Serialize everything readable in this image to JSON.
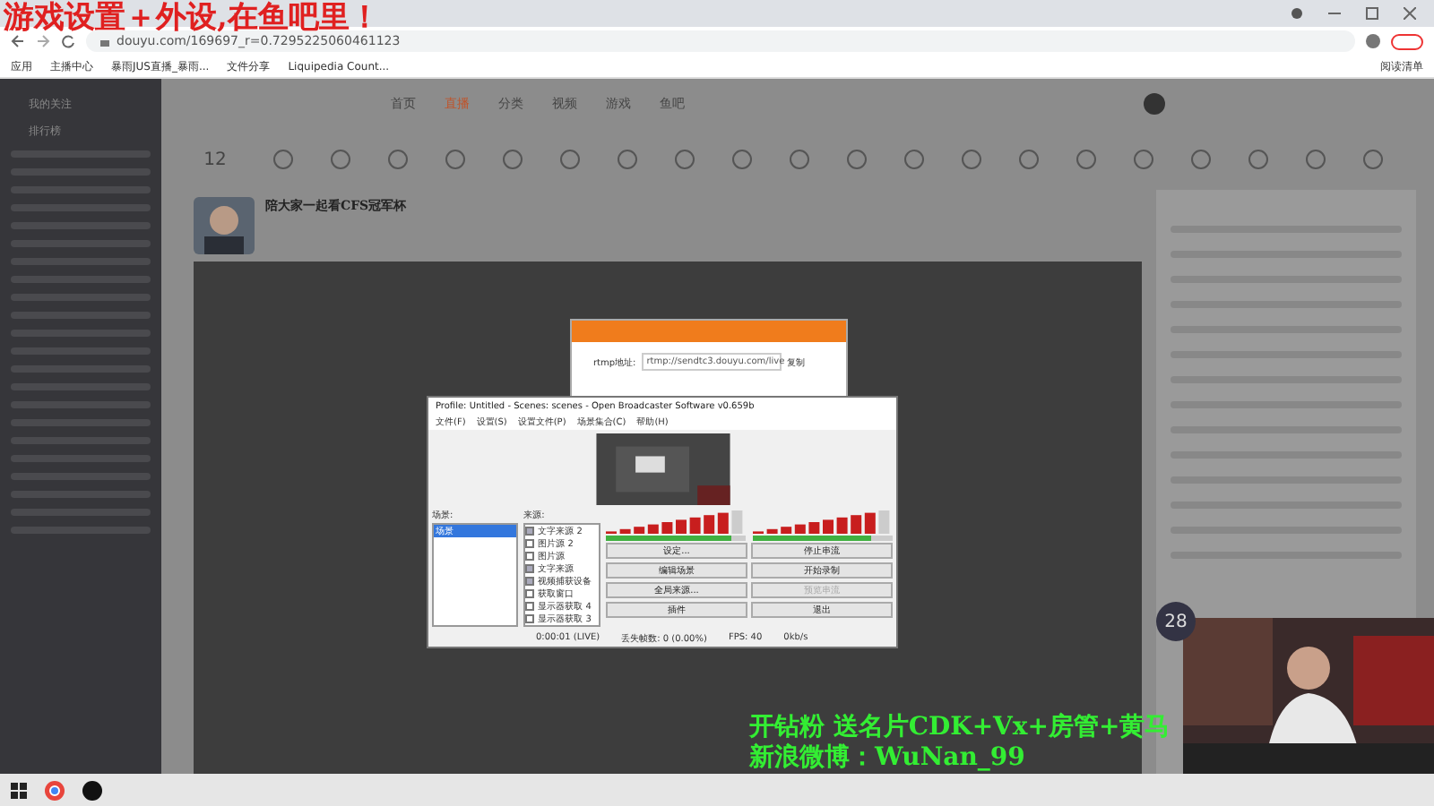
{
  "overlay_caption": "游戏设置＋外设,在鱼吧里！",
  "browser": {
    "url": "douyu.com/169697_r=0.7295225060461123",
    "bookmarks": [
      "应用",
      "主播中心",
      "暴雨JUS直播_暴雨...",
      "文件分享",
      "Liquipedia Count..."
    ],
    "reading_list": "阅读清单"
  },
  "site": {
    "nav": [
      {
        "label": "首页",
        "selected": false
      },
      {
        "label": "直播",
        "selected": true
      },
      {
        "label": "分类",
        "selected": false
      },
      {
        "label": "视频",
        "selected": false
      },
      {
        "label": "游戏",
        "selected": false
      },
      {
        "label": "鱼吧",
        "selected": false
      }
    ],
    "follow_count": "12",
    "sidebar_items": [
      "我的关注",
      "排行榜"
    ],
    "stream_title": "陪大家一起看CFS冠军杯"
  },
  "stream_dialog": {
    "rtmp_label": "rtmp地址:",
    "rtmp_value": "rtmp://sendtc3.douyu.com/live",
    "copy_button": "复制"
  },
  "obs": {
    "title": "Profile: Untitled - Scenes: scenes - Open Broadcaster Software v0.659b",
    "menus": [
      "文件(F)",
      "设置(S)",
      "设置文件(P)",
      "场景集合(C)",
      "帮助(H)"
    ],
    "scenes_label": "场景:",
    "scenes": [
      {
        "label": "场景",
        "selected": true
      }
    ],
    "sources_label": "来源:",
    "sources": [
      {
        "label": "文字来源 2",
        "checked": true
      },
      {
        "label": "图片源 2",
        "checked": false
      },
      {
        "label": "图片源",
        "checked": false
      },
      {
        "label": "文字来源",
        "checked": true
      },
      {
        "label": "视频捕获设备",
        "checked": true
      },
      {
        "label": "获取窗口",
        "checked": false
      },
      {
        "label": "显示器获取 4",
        "checked": false
      },
      {
        "label": "显示器获取 3",
        "checked": false
      }
    ],
    "meters": [
      {
        "level": 0.9
      },
      {
        "level": 0.85
      }
    ],
    "buttons": [
      {
        "label": "设定...",
        "disabled": false
      },
      {
        "label": "停止串流",
        "disabled": false
      },
      {
        "label": "编辑场景",
        "disabled": false
      },
      {
        "label": "开始录制",
        "disabled": false
      },
      {
        "label": "全局来源...",
        "disabled": false
      },
      {
        "label": "预览串流",
        "disabled": true
      },
      {
        "label": "插件",
        "disabled": false
      },
      {
        "label": "退出",
        "disabled": false
      }
    ],
    "status": [
      "0:00:01 (LIVE)",
      "丢失帧数: 0 (0.00%)",
      "FPS: 40",
      "0kb/s"
    ]
  },
  "viewer_count": "28",
  "promo_lines": [
    "开钻粉 送名片CDK+Vx+房管+黄马",
    "新浪微博：WuNan_99"
  ]
}
